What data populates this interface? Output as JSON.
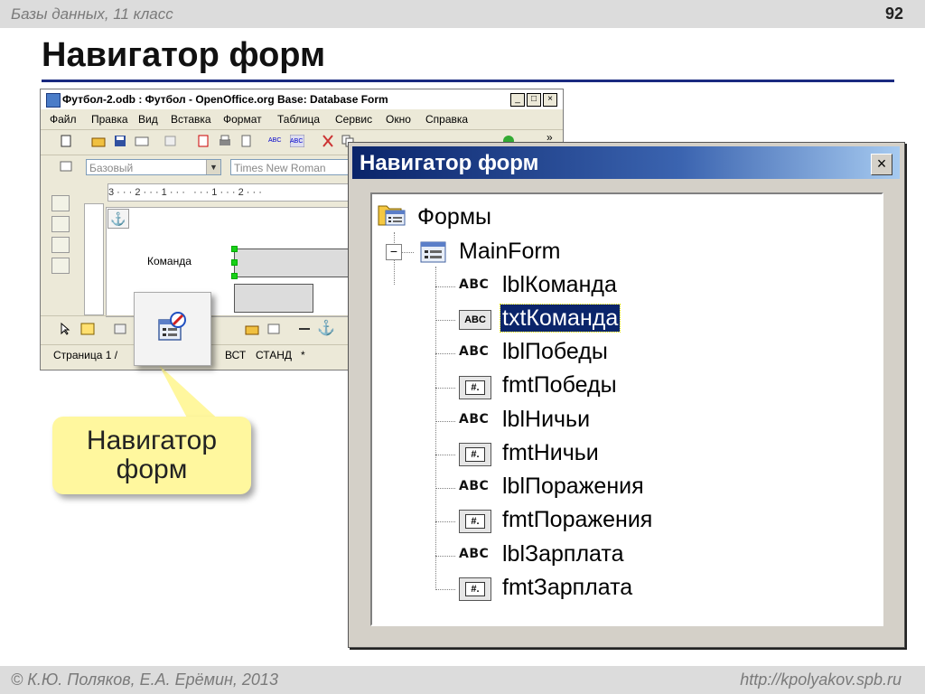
{
  "slide": {
    "course": "Базы данных, 11 класс",
    "page_number": "92",
    "title": "Навигатор форм",
    "footer_left": "© К.Ю. Поляков, Е.А. Ерёмин, 2013",
    "footer_right": "http://kpolyakov.spb.ru"
  },
  "oo_window": {
    "title": "Футбол-2.odb : Футбол - OpenOffice.org Base: Database Form",
    "menu": [
      "Файл",
      "Правка",
      "Вид",
      "Вставка",
      "Формат",
      "Таблица",
      "Сервис",
      "Окно",
      "Справка"
    ],
    "style_combo": "Базовый",
    "font_combo": "Times New Roman",
    "ruler": "3 · · · 2 · · · 1 · · ·   · · · 1 · · · 2 · · ·",
    "label_komanda": "Команда",
    "status_page": "Страница  1 /",
    "status_ins": "ВСТ",
    "status_std": "СТАНД",
    "status_mod": "*"
  },
  "callout": {
    "line1": "Навигатор",
    "line2": "форм"
  },
  "navigator": {
    "title": "Навигатор форм",
    "root": "Формы",
    "form": "MainForm",
    "controls": [
      {
        "name": "lblКоманда",
        "icon": "label-abc-icon"
      },
      {
        "name": "txtКоманда",
        "icon": "textbox-abc-icon",
        "selected": true
      },
      {
        "name": "lblПобеды",
        "icon": "label-abc-icon"
      },
      {
        "name": "fmtПобеды",
        "icon": "formatted-field-icon"
      },
      {
        "name": "lblНичьи",
        "icon": "label-abc-icon"
      },
      {
        "name": "fmtНичьи",
        "icon": "formatted-field-icon"
      },
      {
        "name": "lblПоражения",
        "icon": "label-abc-icon"
      },
      {
        "name": "fmtПоражения",
        "icon": "formatted-field-icon"
      },
      {
        "name": "lblЗарплата",
        "icon": "label-abc-icon"
      },
      {
        "name": "fmtЗарплата",
        "icon": "formatted-field-icon"
      }
    ]
  },
  "colors": {
    "title_rule": "#1a2a80",
    "callout": "#fff79e",
    "selection": "#0a246a"
  }
}
